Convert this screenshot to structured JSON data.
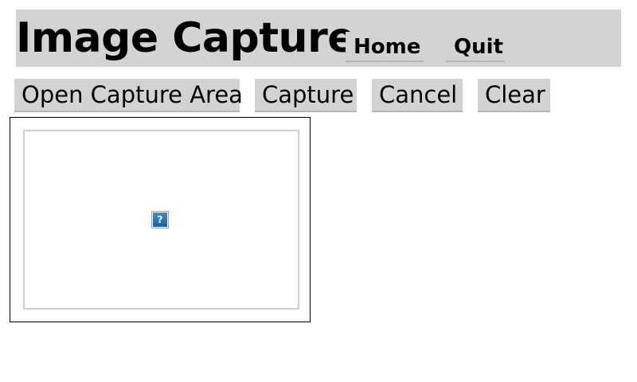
{
  "header": {
    "title": "Image Capture",
    "nav": {
      "home_label": "Home",
      "quit_label": "Quit"
    }
  },
  "toolbar": {
    "open_capture_area_label": "Open Capture Area",
    "capture_label": "Capture",
    "cancel_label": "Cancel",
    "clear_label": "Clear"
  },
  "capture_area": {
    "placeholder_icon": "broken-image-icon",
    "placeholder_glyph": "?"
  },
  "colors": {
    "header_background": "#d3d3d3",
    "button_background": "#d3d3d3",
    "frame_border": "#000000",
    "inner_border": "#cfcfcf",
    "icon_blue": "#2f7fc0"
  }
}
